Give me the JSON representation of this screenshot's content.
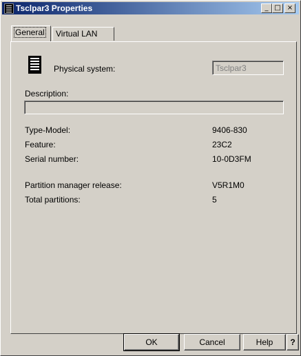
{
  "window": {
    "title": "Tsclpar3 Properties",
    "minimize_glyph": "_",
    "maximize_glyph": "□",
    "close_glyph": "×"
  },
  "tabs": [
    {
      "label": "General",
      "active": true
    },
    {
      "label": "Virtual LAN",
      "active": false
    }
  ],
  "general": {
    "physical_system_label": "Physical system:",
    "physical_system_value": "Tsclpar3",
    "description_label": "Description:",
    "description_value": "",
    "type_model_label": "Type-Model:",
    "type_model_value": "9406-830",
    "feature_label": "Feature:",
    "feature_value": "23C2",
    "serial_label": "Serial number:",
    "serial_value": "10-0D3FM",
    "pm_release_label": "Partition manager release:",
    "pm_release_value": "V5R1M0",
    "total_partitions_label": "Total partitions:",
    "total_partitions_value": "5"
  },
  "buttons": {
    "ok": "OK",
    "cancel": "Cancel",
    "help": "Help",
    "whats_this": "?"
  },
  "icons": {
    "title_icon": "system-unit-icon",
    "physical_system_icon": "server-tower-icon"
  }
}
